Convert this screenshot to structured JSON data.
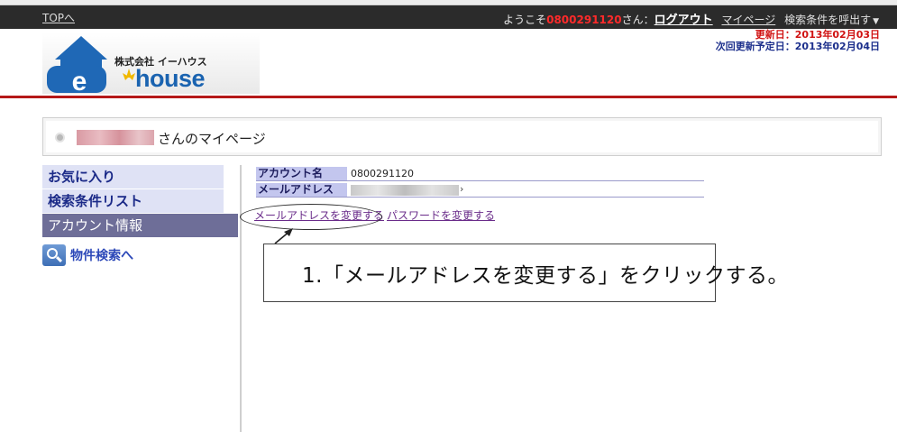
{
  "topbar": {
    "top_link": "TOPへ",
    "welcome_prefix": "ようこそ",
    "user_phone": "0800291120",
    "welcome_suffix": "さん：",
    "logout": "ログアウト",
    "mypage": "マイページ",
    "recall_conditions": "検索条件を呼出す"
  },
  "logo": {
    "company": "株式会社 イーハウス",
    "letter": "e",
    "wordmark": "house"
  },
  "update_info": {
    "updated": "更新日：2013年02月03日",
    "next_update": "次回更新予定日：2013年02月04日"
  },
  "page_title": {
    "suffix": "さんのマイページ"
  },
  "sidebar": {
    "items": [
      {
        "label": "お気に入り"
      },
      {
        "label": "検索条件リスト"
      },
      {
        "label": "アカウント情報"
      }
    ],
    "search_link": "物件検索へ"
  },
  "account": {
    "name_label": "アカウント名",
    "name_value": "0800291120",
    "email_label": "メールアドレス",
    "email_tail": "›"
  },
  "links": {
    "change_email": "メールアドレスを変更する",
    "change_password": "パスワードを変更する"
  },
  "callout": {
    "text": "1.「メールアドレスを変更する」をクリックする。"
  },
  "colors": {
    "accent_red": "#b51818",
    "nav_bg": "#dfe2f5",
    "nav_active": "#6e6e98",
    "link": "#6a2c8a"
  }
}
